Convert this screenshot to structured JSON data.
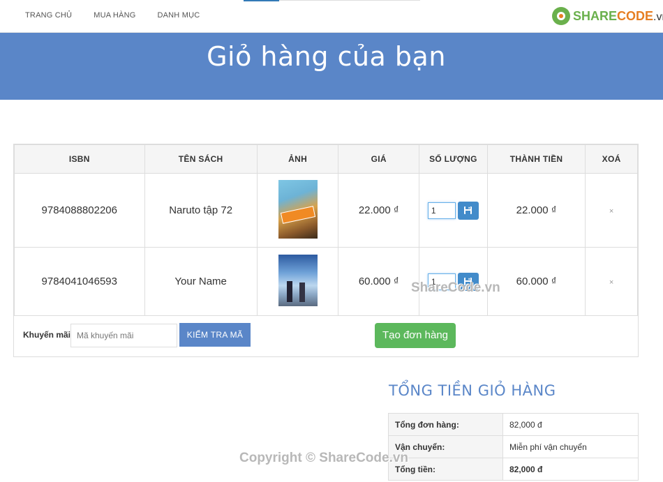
{
  "nav": {
    "links": [
      "TRANG CHỦ",
      "MUA HÀNG",
      "DANH MỤC"
    ]
  },
  "logo": {
    "share": "SHARE",
    "code": "CODE",
    "vn": ".vn"
  },
  "banner": {
    "title": "Giỏ hàng của bạn"
  },
  "cart": {
    "headers": [
      "ISBN",
      "TÊN SÁCH",
      "ẢNH",
      "GIÁ",
      "SỐ LƯỢNG",
      "THÀNH TIỀN",
      "XOÁ"
    ],
    "rows": [
      {
        "isbn": "9784088802206",
        "name": "Naruto tập 72",
        "price": "22.000 ₫",
        "qty": "1",
        "subtotal": "22.000 ₫",
        "remove": "×"
      },
      {
        "isbn": "9784041046593",
        "name": "Your Name",
        "price": "60.000 ₫",
        "qty": "1",
        "subtotal": "60.000 ₫",
        "remove": "×"
      }
    ]
  },
  "promo": {
    "label": "Khuyến mãi:",
    "placeholder": "Mã khuyến mãi",
    "check_label": "KIỂM TRA MÃ"
  },
  "order_button": "Tạo đơn hàng",
  "totals": {
    "title": "TỔNG TIỀN GIỎ HÀNG",
    "rows": [
      {
        "label": "Tổng đơn hàng:",
        "value": "82,000 đ"
      },
      {
        "label": "Vận chuyển:",
        "value": "Miễn phí vận chuyển"
      },
      {
        "label": "Tổng tiền:",
        "value": "82,000 đ"
      }
    ]
  },
  "watermarks": [
    "ShareCode.vn",
    "Copyright © ShareCode.vn"
  ],
  "colors": {
    "banner": "#5a86c8",
    "order_button": "#5cb85c",
    "save_button": "#428bca"
  }
}
